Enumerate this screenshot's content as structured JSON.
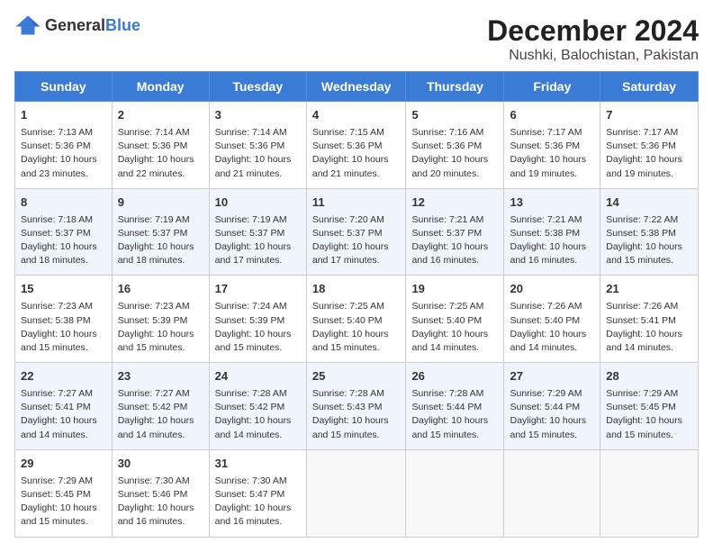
{
  "header": {
    "logo_general": "General",
    "logo_blue": "Blue",
    "month_title": "December 2024",
    "location": "Nushki, Balochistan, Pakistan"
  },
  "days_of_week": [
    "Sunday",
    "Monday",
    "Tuesday",
    "Wednesday",
    "Thursday",
    "Friday",
    "Saturday"
  ],
  "weeks": [
    [
      {
        "day": "1",
        "info": "Sunrise: 7:13 AM\nSunset: 5:36 PM\nDaylight: 10 hours and 23 minutes."
      },
      {
        "day": "2",
        "info": "Sunrise: 7:14 AM\nSunset: 5:36 PM\nDaylight: 10 hours and 22 minutes."
      },
      {
        "day": "3",
        "info": "Sunrise: 7:14 AM\nSunset: 5:36 PM\nDaylight: 10 hours and 21 minutes."
      },
      {
        "day": "4",
        "info": "Sunrise: 7:15 AM\nSunset: 5:36 PM\nDaylight: 10 hours and 21 minutes."
      },
      {
        "day": "5",
        "info": "Sunrise: 7:16 AM\nSunset: 5:36 PM\nDaylight: 10 hours and 20 minutes."
      },
      {
        "day": "6",
        "info": "Sunrise: 7:17 AM\nSunset: 5:36 PM\nDaylight: 10 hours and 19 minutes."
      },
      {
        "day": "7",
        "info": "Sunrise: 7:17 AM\nSunset: 5:36 PM\nDaylight: 10 hours and 19 minutes."
      }
    ],
    [
      {
        "day": "8",
        "info": "Sunrise: 7:18 AM\nSunset: 5:37 PM\nDaylight: 10 hours and 18 minutes."
      },
      {
        "day": "9",
        "info": "Sunrise: 7:19 AM\nSunset: 5:37 PM\nDaylight: 10 hours and 18 minutes."
      },
      {
        "day": "10",
        "info": "Sunrise: 7:19 AM\nSunset: 5:37 PM\nDaylight: 10 hours and 17 minutes."
      },
      {
        "day": "11",
        "info": "Sunrise: 7:20 AM\nSunset: 5:37 PM\nDaylight: 10 hours and 17 minutes."
      },
      {
        "day": "12",
        "info": "Sunrise: 7:21 AM\nSunset: 5:37 PM\nDaylight: 10 hours and 16 minutes."
      },
      {
        "day": "13",
        "info": "Sunrise: 7:21 AM\nSunset: 5:38 PM\nDaylight: 10 hours and 16 minutes."
      },
      {
        "day": "14",
        "info": "Sunrise: 7:22 AM\nSunset: 5:38 PM\nDaylight: 10 hours and 15 minutes."
      }
    ],
    [
      {
        "day": "15",
        "info": "Sunrise: 7:23 AM\nSunset: 5:38 PM\nDaylight: 10 hours and 15 minutes."
      },
      {
        "day": "16",
        "info": "Sunrise: 7:23 AM\nSunset: 5:39 PM\nDaylight: 10 hours and 15 minutes."
      },
      {
        "day": "17",
        "info": "Sunrise: 7:24 AM\nSunset: 5:39 PM\nDaylight: 10 hours and 15 minutes."
      },
      {
        "day": "18",
        "info": "Sunrise: 7:25 AM\nSunset: 5:40 PM\nDaylight: 10 hours and 15 minutes."
      },
      {
        "day": "19",
        "info": "Sunrise: 7:25 AM\nSunset: 5:40 PM\nDaylight: 10 hours and 14 minutes."
      },
      {
        "day": "20",
        "info": "Sunrise: 7:26 AM\nSunset: 5:40 PM\nDaylight: 10 hours and 14 minutes."
      },
      {
        "day": "21",
        "info": "Sunrise: 7:26 AM\nSunset: 5:41 PM\nDaylight: 10 hours and 14 minutes."
      }
    ],
    [
      {
        "day": "22",
        "info": "Sunrise: 7:27 AM\nSunset: 5:41 PM\nDaylight: 10 hours and 14 minutes."
      },
      {
        "day": "23",
        "info": "Sunrise: 7:27 AM\nSunset: 5:42 PM\nDaylight: 10 hours and 14 minutes."
      },
      {
        "day": "24",
        "info": "Sunrise: 7:28 AM\nSunset: 5:42 PM\nDaylight: 10 hours and 14 minutes."
      },
      {
        "day": "25",
        "info": "Sunrise: 7:28 AM\nSunset: 5:43 PM\nDaylight: 10 hours and 15 minutes."
      },
      {
        "day": "26",
        "info": "Sunrise: 7:28 AM\nSunset: 5:44 PM\nDaylight: 10 hours and 15 minutes."
      },
      {
        "day": "27",
        "info": "Sunrise: 7:29 AM\nSunset: 5:44 PM\nDaylight: 10 hours and 15 minutes."
      },
      {
        "day": "28",
        "info": "Sunrise: 7:29 AM\nSunset: 5:45 PM\nDaylight: 10 hours and 15 minutes."
      }
    ],
    [
      {
        "day": "29",
        "info": "Sunrise: 7:29 AM\nSunset: 5:45 PM\nDaylight: 10 hours and 15 minutes."
      },
      {
        "day": "30",
        "info": "Sunrise: 7:30 AM\nSunset: 5:46 PM\nDaylight: 10 hours and 16 minutes."
      },
      {
        "day": "31",
        "info": "Sunrise: 7:30 AM\nSunset: 5:47 PM\nDaylight: 10 hours and 16 minutes."
      },
      {
        "day": "",
        "info": ""
      },
      {
        "day": "",
        "info": ""
      },
      {
        "day": "",
        "info": ""
      },
      {
        "day": "",
        "info": ""
      }
    ]
  ]
}
